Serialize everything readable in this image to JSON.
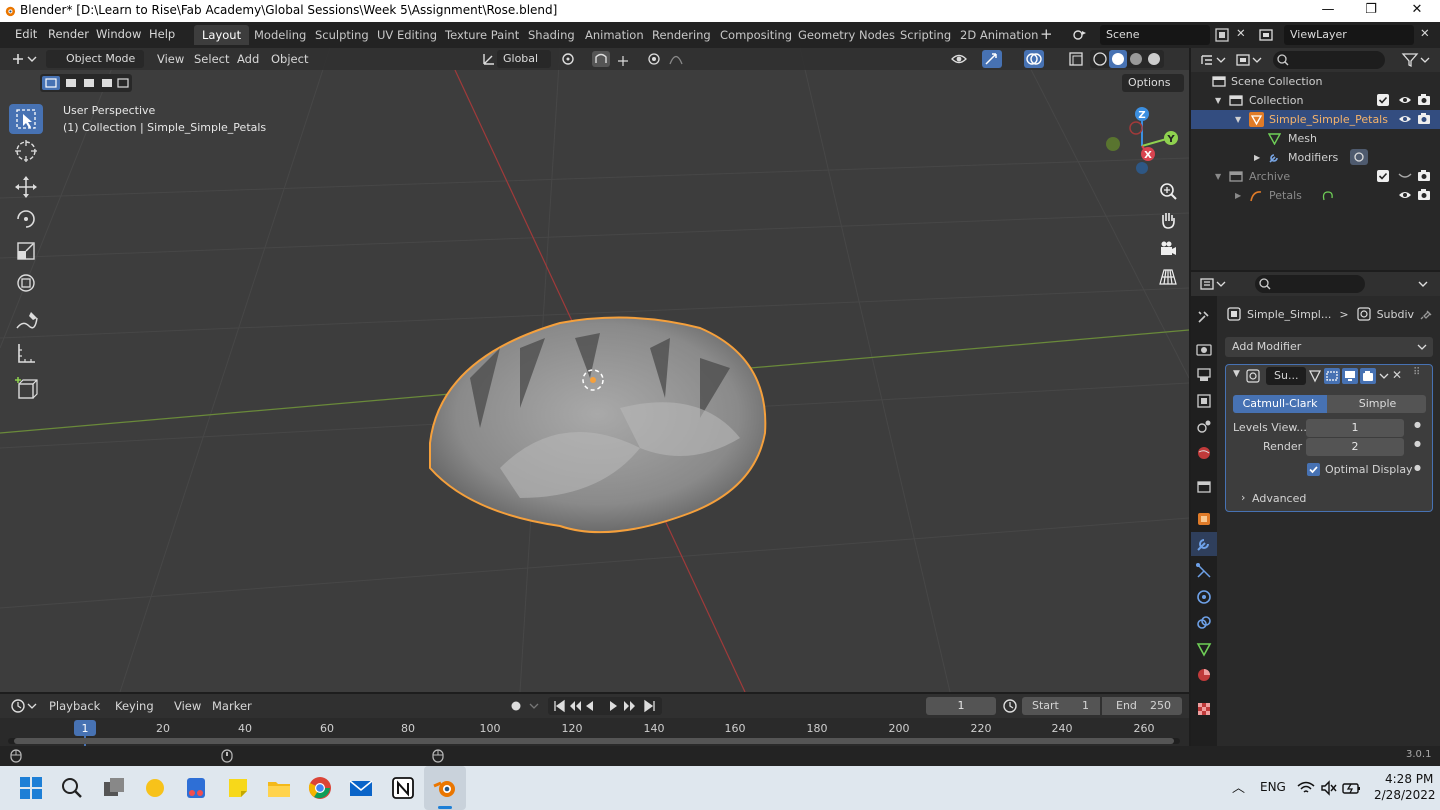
{
  "window": {
    "title": "Blender* [D:\\Learn to Rise\\Fab Academy\\Global Sessions\\Week 5\\Assignment\\Rose.blend]",
    "minimize": "—",
    "maximize": "❐",
    "close": "✕"
  },
  "menus": [
    "Edit",
    "Render",
    "Window",
    "Help"
  ],
  "workspaces": [
    "Layout",
    "Modeling",
    "Sculpting",
    "UV Editing",
    "Texture Paint",
    "Shading",
    "Animation",
    "Rendering",
    "Compositing",
    "Geometry Nodes",
    "Scripting",
    "2D Animation"
  ],
  "workspace_add": "+",
  "scene": "Scene",
  "view_layer": "ViewLayer",
  "viewport": {
    "mode": "Object Mode",
    "menus": [
      "View",
      "Select",
      "Add",
      "Object"
    ],
    "orientation": "Global",
    "options": "Options",
    "perspective": "User Perspective",
    "collection_info": "(1) Collection | Simple_Simple_Petals",
    "gizmo": {
      "x": "X",
      "y": "Y",
      "z": "Z"
    }
  },
  "outliner": {
    "rows": [
      {
        "label": "Scene Collection"
      },
      {
        "label": "Collection"
      },
      {
        "label": "Simple_Simple_Petals"
      },
      {
        "label": "Mesh"
      },
      {
        "label": "Modifiers"
      },
      {
        "label": "Archive"
      },
      {
        "label": "Petals"
      }
    ]
  },
  "properties": {
    "breadcrumb_object": "Simple_Simpl...",
    "breadcrumb_sep": ">",
    "breadcrumb_modifier": "Subdiv",
    "add_modifier": "Add Modifier",
    "modifier_name": "Su...",
    "subdiv_types": [
      "Catmull-Clark",
      "Simple"
    ],
    "levels_viewport_label": "Levels View...",
    "levels_viewport_value": "1",
    "render_label": "Render",
    "render_value": "2",
    "optimal_display": "Optimal Display",
    "advanced": "Advanced"
  },
  "timeline": {
    "menus": [
      "Playback",
      "Keying",
      "View",
      "Marker"
    ],
    "current_frame": "1",
    "start_label": "Start",
    "start_value": "1",
    "end_label": "End",
    "end_value": "250",
    "ticks": [
      "1",
      "20",
      "40",
      "60",
      "80",
      "100",
      "120",
      "140",
      "160",
      "180",
      "200",
      "220",
      "240",
      "260"
    ]
  },
  "status": {
    "version": "3.0.1"
  },
  "taskbar": {
    "lang": "ENG",
    "time": "4:28 PM",
    "date": "2/28/2022"
  },
  "colors": {
    "accent": "#4772b3",
    "selection_outline": "#f5a03c",
    "x_axis": "#d9434f",
    "y_axis": "#8fd14f",
    "z_axis": "#3c8fe0"
  }
}
